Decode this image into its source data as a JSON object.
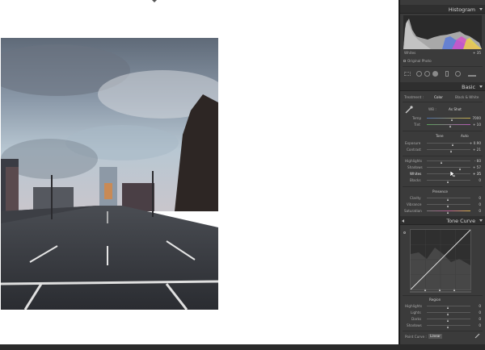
{
  "histogram": {
    "title": "Histogram",
    "info_left": "Whites",
    "info_right": "+ 35",
    "original_photo_label": "Original Photo"
  },
  "basic": {
    "title": "Basic",
    "treatment_label": "Treatment :",
    "color_label": "Color",
    "bw_label": "Black & White",
    "wb_label": "WB :",
    "wb_value": "As Shot",
    "temp_label": "Temp",
    "temp_value": "7000",
    "tint_label": "Tint",
    "tint_value": "+ 10",
    "tone_label": "Tone",
    "auto_label": "Auto",
    "exposure_label": "Exposure",
    "exposure_value": "+ 0.90",
    "contrast_label": "Contrast",
    "contrast_value": "+ 21",
    "highlights_label": "Highlights",
    "highlights_value": "- 60",
    "shadows_label": "Shadows",
    "shadows_value": "+ 57",
    "whites_label": "Whites",
    "whites_value": "+ 35",
    "blacks_label": "Blacks",
    "blacks_value": "0",
    "presence_label": "Presence",
    "clarity_label": "Clarity",
    "clarity_value": "0",
    "vibrance_label": "Vibrance",
    "vibrance_value": "0",
    "saturation_label": "Saturation",
    "saturation_value": "0"
  },
  "tone_curve": {
    "title": "Tone Curve",
    "region_label": "Region",
    "highlights_label": "Highlights",
    "highlights_value": "0",
    "lights_label": "Lights",
    "lights_value": "0",
    "darks_label": "Darks",
    "darks_value": "0",
    "shadows_label": "Shadows",
    "shadows_value": "0",
    "point_curve_label": "Point Curve :",
    "point_curve_value": "Linear"
  },
  "sliders": {
    "temp": 0.58,
    "tint": 0.55,
    "exposure": 0.6,
    "contrast": 0.57,
    "highlights": 0.35,
    "shadows": 0.77,
    "whites": 0.65,
    "blacks": 0.5,
    "clarity": 0.5,
    "vibrance": 0.5,
    "saturation": 0.5,
    "tc_highlights": 0.5,
    "tc_lights": 0.5,
    "tc_darks": 0.5,
    "tc_shadows": 0.5
  },
  "colors": {
    "panel_bg": "#3b3b3b",
    "panel_header": "#2f2f2f",
    "sky": "#9fb0c0",
    "road": "#3a3d42"
  }
}
